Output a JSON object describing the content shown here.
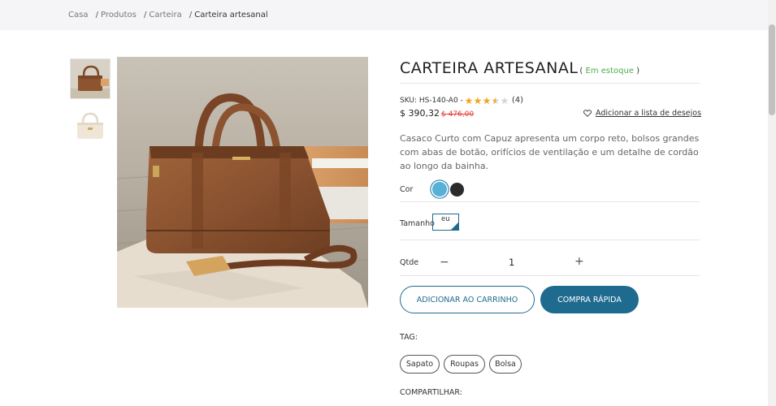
{
  "breadcrumb": {
    "items": [
      "Casa",
      "Produtos",
      "Carteira"
    ],
    "separator": "/",
    "current": "Carteira artesanal"
  },
  "product": {
    "title": "CARTEIRA ARTESANAL",
    "stock_open": "(",
    "stock": "Em estoque",
    "stock_close": ")",
    "sku": "SKU: HS-140-A0 -",
    "rating": 3.5,
    "review_count": "(4)",
    "price": "$ 390,32",
    "old_price": "$ 476,00",
    "wishlist_label": "Adicionar a lista de desejos",
    "description": "Casaco Curto com Capuz apresenta um corpo reto, bolsos grandes com abas de botão, orifícios de ventilação e um detalhe de cordão ao longo da bainha."
  },
  "options": {
    "color_label": "Cor",
    "colors": [
      "#57b0d6",
      "#2b2b2b"
    ],
    "size_label": "Tamanho",
    "size_value": "eu",
    "qty_label": "Qtde",
    "qty_minus": "−",
    "qty_value": "1",
    "qty_plus": "+"
  },
  "actions": {
    "add_to_cart": "ADICIONAR AO CARRINHO",
    "quick_buy": "COMPRA RÁPIDA"
  },
  "tags": {
    "label": "TAG:",
    "items": [
      "Sapato",
      "Roupas",
      "Bolsa"
    ]
  },
  "share": {
    "label": "COMPARTILHAR:"
  },
  "colors": {
    "accent": "#1f6b8f",
    "stock_green": "#4caf50",
    "old_price_red": "#e53935",
    "star": "#f5a623"
  }
}
